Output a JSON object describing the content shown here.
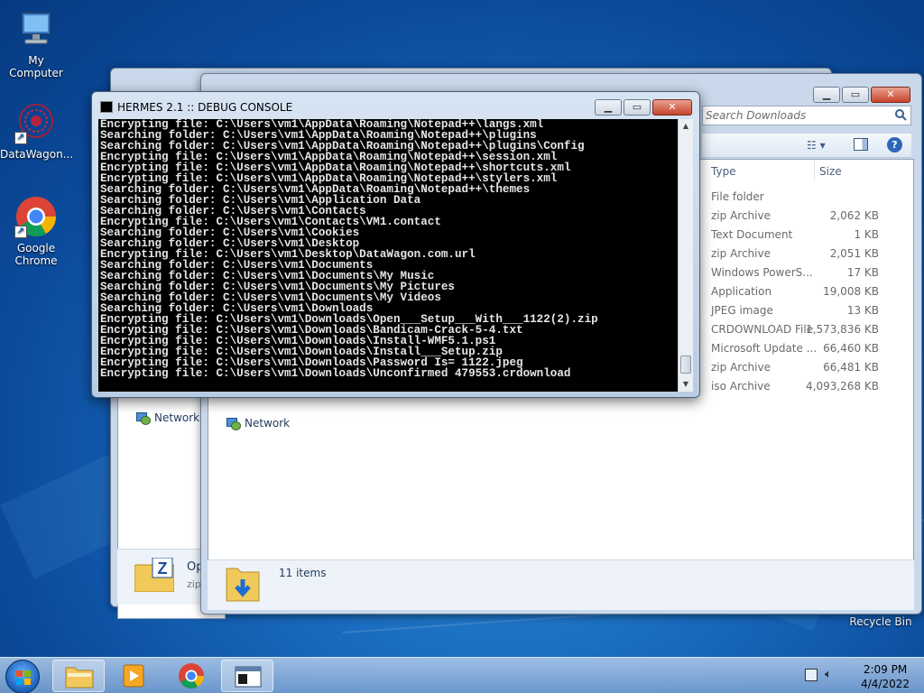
{
  "desktop": {
    "icons": [
      {
        "label": "My Computer"
      },
      {
        "label": "DataWagon..."
      },
      {
        "label": "Google Chrome"
      },
      {
        "label": "Recycle Bin"
      }
    ]
  },
  "console": {
    "title": "HERMES 2.1 :: DEBUG CONSOLE",
    "lines": [
      "Encrypting file: C:\\Users\\vm1\\AppData\\Roaming\\Notepad++\\langs.xml",
      "Searching folder: C:\\Users\\vm1\\AppData\\Roaming\\Notepad++\\plugins",
      "Searching folder: C:\\Users\\vm1\\AppData\\Roaming\\Notepad++\\plugins\\Config",
      "Encrypting file: C:\\Users\\vm1\\AppData\\Roaming\\Notepad++\\session.xml",
      "Encrypting file: C:\\Users\\vm1\\AppData\\Roaming\\Notepad++\\shortcuts.xml",
      "Encrypting file: C:\\Users\\vm1\\AppData\\Roaming\\Notepad++\\stylers.xml",
      "Searching folder: C:\\Users\\vm1\\AppData\\Roaming\\Notepad++\\themes",
      "Searching folder: C:\\Users\\vm1\\Application Data",
      "Searching folder: C:\\Users\\vm1\\Contacts",
      "Encrypting file: C:\\Users\\vm1\\Contacts\\VM1.contact",
      "Searching folder: C:\\Users\\vm1\\Cookies",
      "Searching folder: C:\\Users\\vm1\\Desktop",
      "Encrypting file: C:\\Users\\vm1\\Desktop\\DataWagon.com.url",
      "Searching folder: C:\\Users\\vm1\\Documents",
      "Searching folder: C:\\Users\\vm1\\Documents\\My Music",
      "Searching folder: C:\\Users\\vm1\\Documents\\My Pictures",
      "Searching folder: C:\\Users\\vm1\\Documents\\My Videos",
      "Searching folder: C:\\Users\\vm1\\Downloads",
      "Encrypting file: C:\\Users\\vm1\\Downloads\\Open___Setup___With___1122(2).zip",
      "Encrypting file: C:\\Users\\vm1\\Downloads\\Bandicam-Crack-5-4.txt",
      "Encrypting file: C:\\Users\\vm1\\Downloads\\Install-WMF5.1.ps1",
      "Encrypting file: C:\\Users\\vm1\\Downloads\\Install___Setup.zip",
      "Encrypting file: C:\\Users\\vm1\\Downloads\\Password Is= 1122.jpeg",
      "Encrypting file: C:\\Users\\vm1\\Downloads\\Unconfirmed 479553.crdownload"
    ]
  },
  "explorer": {
    "search_placeholder": "Search Downloads",
    "columns": {
      "type": "Type",
      "size": "Size"
    },
    "rows": [
      {
        "type": "File folder",
        "size": ""
      },
      {
        "type": "zip Archive",
        "size": "2,062 KB"
      },
      {
        "type": "Text Document",
        "size": "1 KB"
      },
      {
        "type": "zip Archive",
        "size": "2,051 KB"
      },
      {
        "type": "Windows PowerS...",
        "size": "17 KB"
      },
      {
        "type": "Application",
        "size": "19,008 KB"
      },
      {
        "type": "JPEG image",
        "size": "13 KB"
      },
      {
        "type": "CRDOWNLOAD File",
        "size": "1,573,836 KB"
      },
      {
        "type": "Microsoft Update ...",
        "size": "66,460 KB"
      },
      {
        "type": "zip Archive",
        "size": "66,481 KB"
      },
      {
        "type": "iso Archive",
        "size": "4,093,268 KB"
      }
    ],
    "nav_network": "Network",
    "status": "11 items"
  },
  "back_explorer": {
    "nav_network": "Network",
    "detail_name": "Op",
    "detail_type": "zip"
  },
  "taskbar": {
    "time": "2:09 PM",
    "date": "4/4/2022"
  }
}
